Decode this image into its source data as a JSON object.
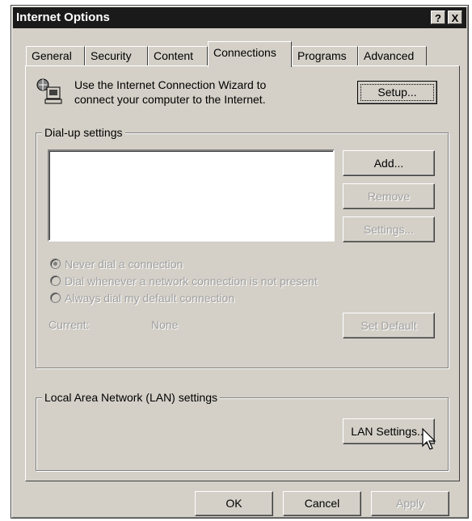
{
  "window": {
    "title": "Internet Options",
    "help_glyph": "?",
    "close_glyph": "X"
  },
  "tabs": [
    {
      "label": "General"
    },
    {
      "label": "Security"
    },
    {
      "label": "Content"
    },
    {
      "label": "Connections",
      "active": true
    },
    {
      "label": "Programs"
    },
    {
      "label": "Advanced"
    }
  ],
  "wizard": {
    "text_line1": "Use the Internet Connection Wizard to",
    "text_line2": "connect your computer to the Internet.",
    "setup_label": "Setup...",
    "icon": "network-computer-icon"
  },
  "dialup": {
    "group_label": "Dial-up settings",
    "add_label": "Add...",
    "remove_label": "Remove",
    "settings_label": "Settings...",
    "radio_never": "Never dial a connection",
    "radio_whenever": "Dial whenever a network connection is not present",
    "radio_always": "Always dial my default connection",
    "current_label": "Current:",
    "current_value": "None",
    "set_default_label": "Set Default"
  },
  "lan": {
    "group_label": "Local Area Network (LAN) settings",
    "lan_settings_label": "LAN Settings..."
  },
  "footer": {
    "ok_label": "OK",
    "cancel_label": "Cancel",
    "apply_label": "Apply"
  },
  "colors": {
    "face": "#d4d0c8",
    "titlebar": "#1a1a1a",
    "disabled_text": "#a0a0a0"
  }
}
